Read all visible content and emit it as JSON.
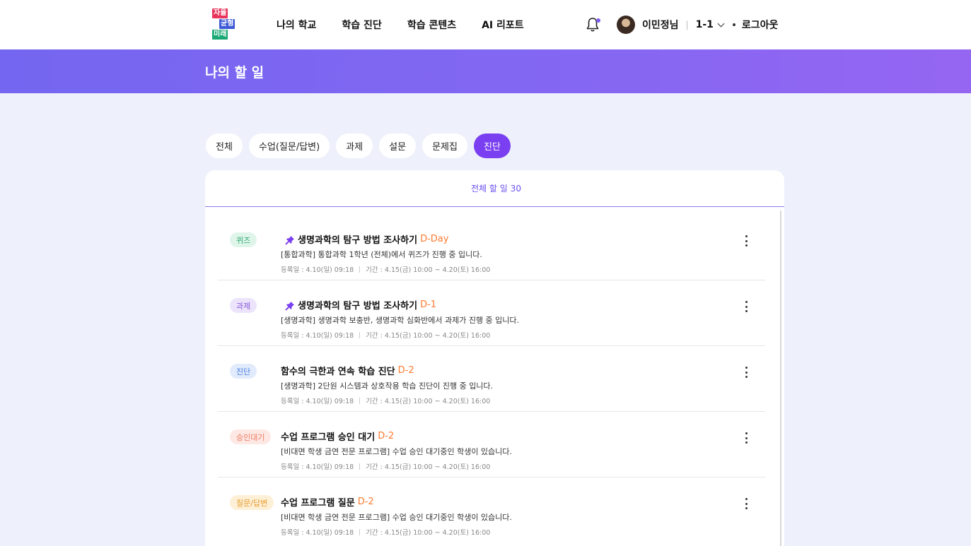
{
  "logo": {
    "line1": "자율",
    "line2": "균형",
    "line3": "미래"
  },
  "nav": [
    "나의 학교",
    "학습 진단",
    "학습 콘텐츠",
    "AI 리포트"
  ],
  "user": {
    "name": "이민정님",
    "class": "1-1",
    "logout": "로그아웃"
  },
  "banner": {
    "title": "나의 할 일"
  },
  "tabs": [
    "전체",
    "수업(질문/답변)",
    "과제",
    "설문",
    "문제집",
    "진단"
  ],
  "active_tab": "진단",
  "panel": {
    "head_label": "전체 할 일",
    "head_count": "30"
  },
  "items": [
    {
      "badge": "퀴즈",
      "badge_bg": "#dff5ea",
      "badge_fg": "#2fa872",
      "pinned": true,
      "title": "생명과학의 탐구 방법 조사하기",
      "dday": "D-Day",
      "desc": "[통합과학] 통합과학 1학년 (전체)에서 퀴즈가 진행 중 입니다.",
      "reg": "등록일 : 4.10(일) 09:18",
      "period": "기간 : 4.15(금) 10:00 ~ 4.20(토) 16:00"
    },
    {
      "badge": "과제",
      "badge_bg": "#ece4fb",
      "badge_fg": "#8a5ad8",
      "pinned": true,
      "title": "생명과학의 탐구 방법 조사하기",
      "dday": "D-1",
      "desc": "[생명과학] 생명과학 보충반, 생명과학 심화반에서 과제가 진행 중 입니다.",
      "reg": "등록일 : 4.10(일) 09:18",
      "period": "기간 : 4.15(금) 10:00 ~ 4.20(토) 16:00"
    },
    {
      "badge": "진단",
      "badge_bg": "#e1ebfb",
      "badge_fg": "#4a7fe0",
      "pinned": false,
      "title": "함수의 극한과 연속 학습 진단",
      "dday": "D-2",
      "desc": "[생명과학] 2단원 시스템과 상호작용 학습 진단이 진행 중 입니다.",
      "reg": "등록일 : 4.10(일) 09:18",
      "period": "기간 : 4.15(금) 10:00 ~ 4.20(토) 16:00"
    },
    {
      "badge": "승인대기",
      "badge_bg": "#fde8e4",
      "badge_fg": "#ee7b62",
      "pinned": false,
      "title": "수업 프로그램 승인 대기",
      "dday": "D-2",
      "desc": "[비대면 학생 금연 전문 프로그램] 수업 승인 대기중인 학생이 있습니다.",
      "reg": "등록일 : 4.10(일) 09:18",
      "period": "기간 : 4.15(금) 10:00 ~ 4.20(토) 16:00"
    },
    {
      "badge": "질문/답변",
      "badge_bg": "#fdf0d6",
      "badge_fg": "#e89a2c",
      "pinned": false,
      "title": "수업 프로그램 질문",
      "dday": "D-2",
      "desc": "[비대면 학생 금연 전문 프로그램] 수업 승인 대기중인 학생이 있습니다.",
      "reg": "등록일 : 4.10(일) 09:18",
      "period": "기간 : 4.15(금) 10:00 ~ 4.20(토) 16:00"
    }
  ],
  "icons": {
    "pin": "pin-icon",
    "bell": "bell-icon",
    "more": "more-vertical-icon",
    "chevron": "chevron-down-icon"
  },
  "colors": {
    "accent": "#7a3ff0",
    "dday": "#ff7a2f",
    "pin": "#7a3ff0"
  }
}
